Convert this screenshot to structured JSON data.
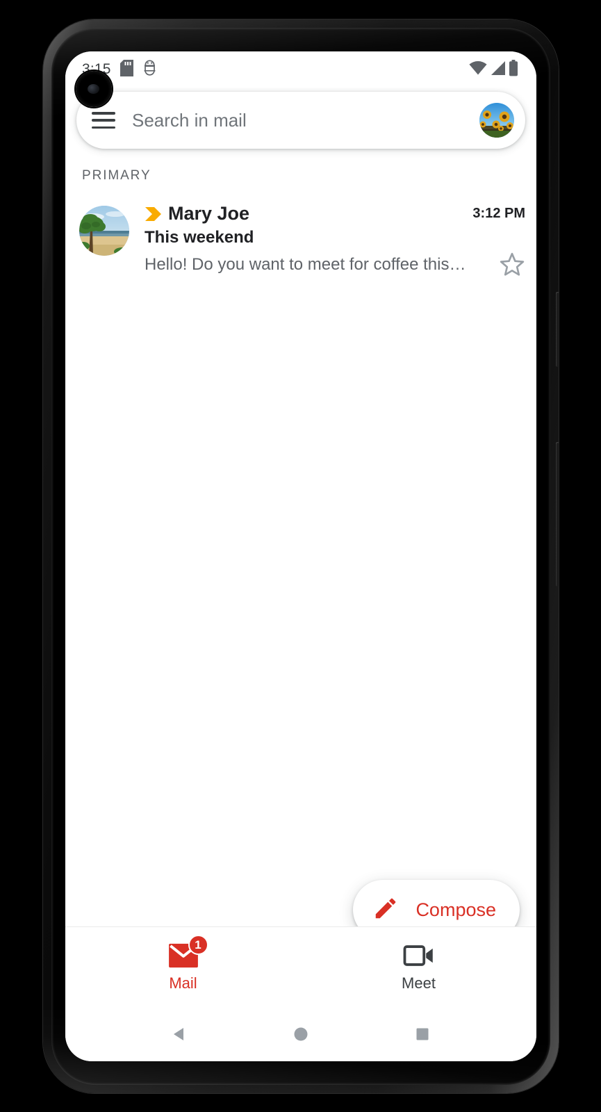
{
  "device": {
    "name": "android-phone",
    "camera_cutout": "front-camera"
  },
  "status_bar": {
    "time": "3:15",
    "icons": [
      "sd-card-icon",
      "usb-debugging-icon",
      "wifi-icon",
      "cellular-signal-icon",
      "battery-full-icon"
    ]
  },
  "search": {
    "placeholder": "Search in mail",
    "menu_icon": "hamburger-menu-icon",
    "avatar": "account-avatar"
  },
  "sections": {
    "primary_label": "PRIMARY"
  },
  "emails": [
    {
      "sender": "Mary Joe",
      "subject": "This weekend",
      "snippet": "Hello! Do you want to meet for coffee this…",
      "time": "3:12 PM",
      "important": true,
      "starred": false,
      "avatar": "tree-beach-photo"
    }
  ],
  "compose": {
    "label": "Compose",
    "icon": "pencil-icon"
  },
  "bottom_nav": {
    "items": [
      {
        "label": "Mail",
        "icon": "envelope-icon",
        "active": true,
        "badge": "1"
      },
      {
        "label": "Meet",
        "icon": "video-camera-icon",
        "active": false,
        "badge": ""
      }
    ]
  },
  "system_nav": {
    "back": "back-triangle-icon",
    "home": "home-circle-icon",
    "recents": "recents-square-icon"
  },
  "colors": {
    "accent_red": "#d93025",
    "important_yellow": "#f9ab00",
    "text_primary": "#202124",
    "text_secondary": "#5f6368"
  }
}
